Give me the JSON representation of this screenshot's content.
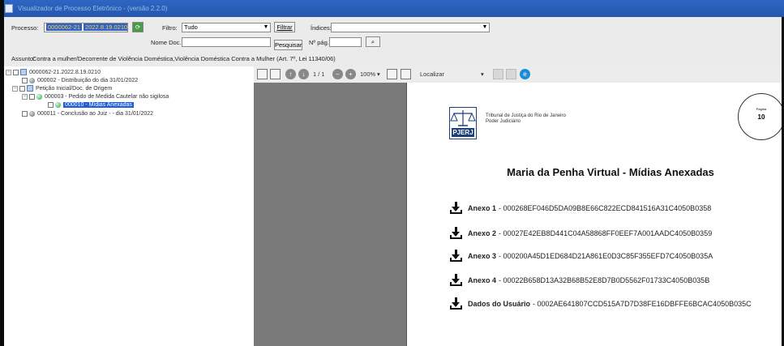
{
  "window": {
    "title": "Visualizador de Processo Eletrônico - (versão 2.2.0)"
  },
  "header": {
    "processo_label": "Processo:",
    "processo_value_1": "0000062-21",
    "processo_value_2": "2022.8.19.0210",
    "filtro_label": "Filtro:",
    "filtro_value": "Tudo",
    "filtrar_button": "Filtrar",
    "indices_label": "Índices:",
    "indices_value": "",
    "nome_doc_label": "Nome Doc.:",
    "nome_doc_value": "",
    "pesquisar_button": "Pesquisar",
    "npag_label": "Nº pág.:",
    "npag_value": "",
    "assunto_label": "Assunto:",
    "assunto_value": "Contra a mulher/Decorrente de Violência Doméstica,Violência Doméstica Contra a Mulher (Art. 7º, Lei 11340/06)"
  },
  "tree": {
    "root": "0000062-21.2022.8.19.0210",
    "items": [
      {
        "label": "000002 - Distribuição do dia 31/01/2022"
      },
      {
        "label": "Petição Inicial/Doc. de Origem"
      },
      {
        "label": "000003 - Pedido de Medida Cautelar não sigilosa"
      },
      {
        "label": "000010 - Mídias Anexadas"
      },
      {
        "label": "000011 - Conclusão ao Juiz - - dia 31/01/2022"
      }
    ]
  },
  "viewer": {
    "page_indicator": "1 / 1",
    "zoom": "100%",
    "find_label": "Localizar"
  },
  "document": {
    "logo_text": "PJERJ",
    "court_line_1": "Tribunal de Justiça do Rio de Janeiro",
    "court_line_2": "Poder Judiciário",
    "stamp_label": "Pagina",
    "stamp_number": "10",
    "title": "Maria da Penha Virtual - Mídias Anexadas",
    "annexes": [
      {
        "name": "Anexo 1",
        "hash": "- 000268EF046D5DA09B8E66C822ECD841516A31C4050B0358"
      },
      {
        "name": "Anexo 2",
        "hash": "- 00027E42EB8D441C04A58868FF0EEF7A001AADC4050B0359"
      },
      {
        "name": "Anexo 3",
        "hash": "- 000200A45D1ED684D21A861E0D3C85F355EFD7C4050B035A"
      },
      {
        "name": "Anexo 4",
        "hash": "- 00022B658D13A32B68B52E8D7B0D5562F01733C4050B035B"
      },
      {
        "name": "Dados do Usuário",
        "hash": "- 0002AE641807CCD515A7D7D38FE16DBFFE6BCAC4050B035C"
      }
    ]
  }
}
